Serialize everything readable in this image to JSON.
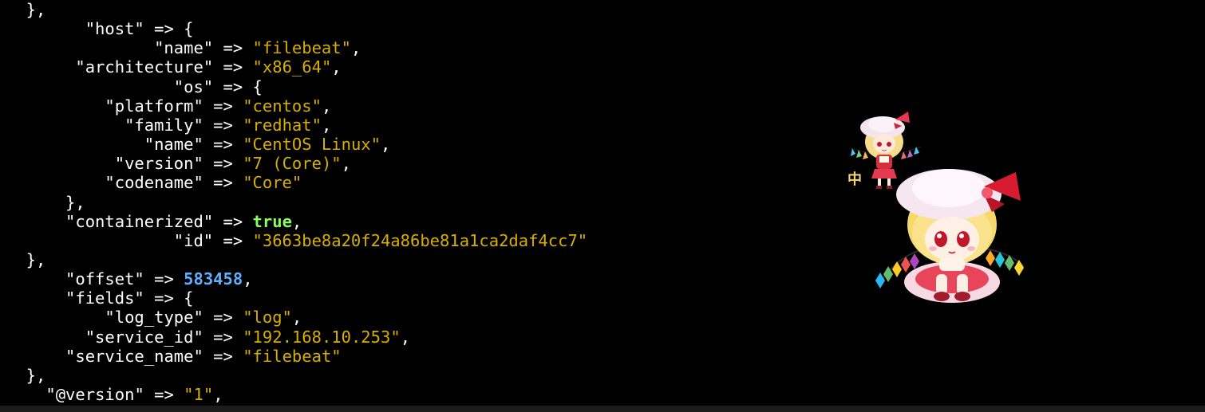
{
  "terminal": {
    "lines": [
      {
        "indent": "  ",
        "key": null,
        "val": null,
        "type": null,
        "tail": "},"
      },
      {
        "indent": "        ",
        "key": "\"host\"",
        "val": null,
        "type": null,
        "tail": " => {"
      },
      {
        "indent": "               ",
        "key": "\"name\"",
        "val": "\"filebeat\"",
        "type": "str",
        "tail": ","
      },
      {
        "indent": "       ",
        "key": "\"architecture\"",
        "val": "\"x86_64\"",
        "type": "str",
        "tail": ","
      },
      {
        "indent": "                 ",
        "key": "\"os\"",
        "val": null,
        "type": null,
        "tail": " => {"
      },
      {
        "indent": "          ",
        "key": "\"platform\"",
        "val": "\"centos\"",
        "type": "str",
        "tail": ","
      },
      {
        "indent": "            ",
        "key": "\"family\"",
        "val": "\"redhat\"",
        "type": "str",
        "tail": ","
      },
      {
        "indent": "              ",
        "key": "\"name\"",
        "val": "\"CentOS Linux\"",
        "type": "str",
        "tail": ","
      },
      {
        "indent": "           ",
        "key": "\"version\"",
        "val": "\"7 (Core)\"",
        "type": "str",
        "tail": ","
      },
      {
        "indent": "          ",
        "key": "\"codename\"",
        "val": "\"Core\"",
        "type": "str",
        "tail": ""
      },
      {
        "indent": "      ",
        "key": null,
        "val": null,
        "type": null,
        "tail": "},"
      },
      {
        "indent": "      ",
        "key": "\"containerized\"",
        "val": "true",
        "type": "bool",
        "tail": ","
      },
      {
        "indent": "                 ",
        "key": "\"id\"",
        "val": "\"3663be8a20f24a86be81a1ca2daf4cc7\"",
        "type": "str",
        "tail": ""
      },
      {
        "indent": "  ",
        "key": null,
        "val": null,
        "type": null,
        "tail": "},"
      },
      {
        "indent": "      ",
        "key": "\"offset\"",
        "val": "583458",
        "type": "num",
        "tail": ","
      },
      {
        "indent": "      ",
        "key": "\"fields\"",
        "val": null,
        "type": null,
        "tail": " => {"
      },
      {
        "indent": "          ",
        "key": "\"log_type\"",
        "val": "\"log\"",
        "type": "str",
        "tail": ","
      },
      {
        "indent": "        ",
        "key": "\"service_id\"",
        "val": "\"192.168.10.253\"",
        "type": "str",
        "tail": ","
      },
      {
        "indent": "      ",
        "key": "\"service_name\"",
        "val": "\"filebeat\"",
        "type": "str",
        "tail": ""
      },
      {
        "indent": "  ",
        "key": null,
        "val": null,
        "type": null,
        "tail": "},"
      },
      {
        "indent": "    ",
        "key": "\"@version\"",
        "val": "\"1\"",
        "type": "str",
        "tail": ","
      }
    ],
    "colors": {
      "background": "#000000",
      "text": "#ffffff",
      "string": "#d7af00",
      "boolean": "#87ff5f",
      "number": "#5fafff"
    }
  },
  "overlay": {
    "small_sticker": {
      "icon": "chibi-character-small-icon",
      "badge_text": "中"
    },
    "large_sticker": {
      "icon": "chibi-character-large-icon"
    }
  }
}
